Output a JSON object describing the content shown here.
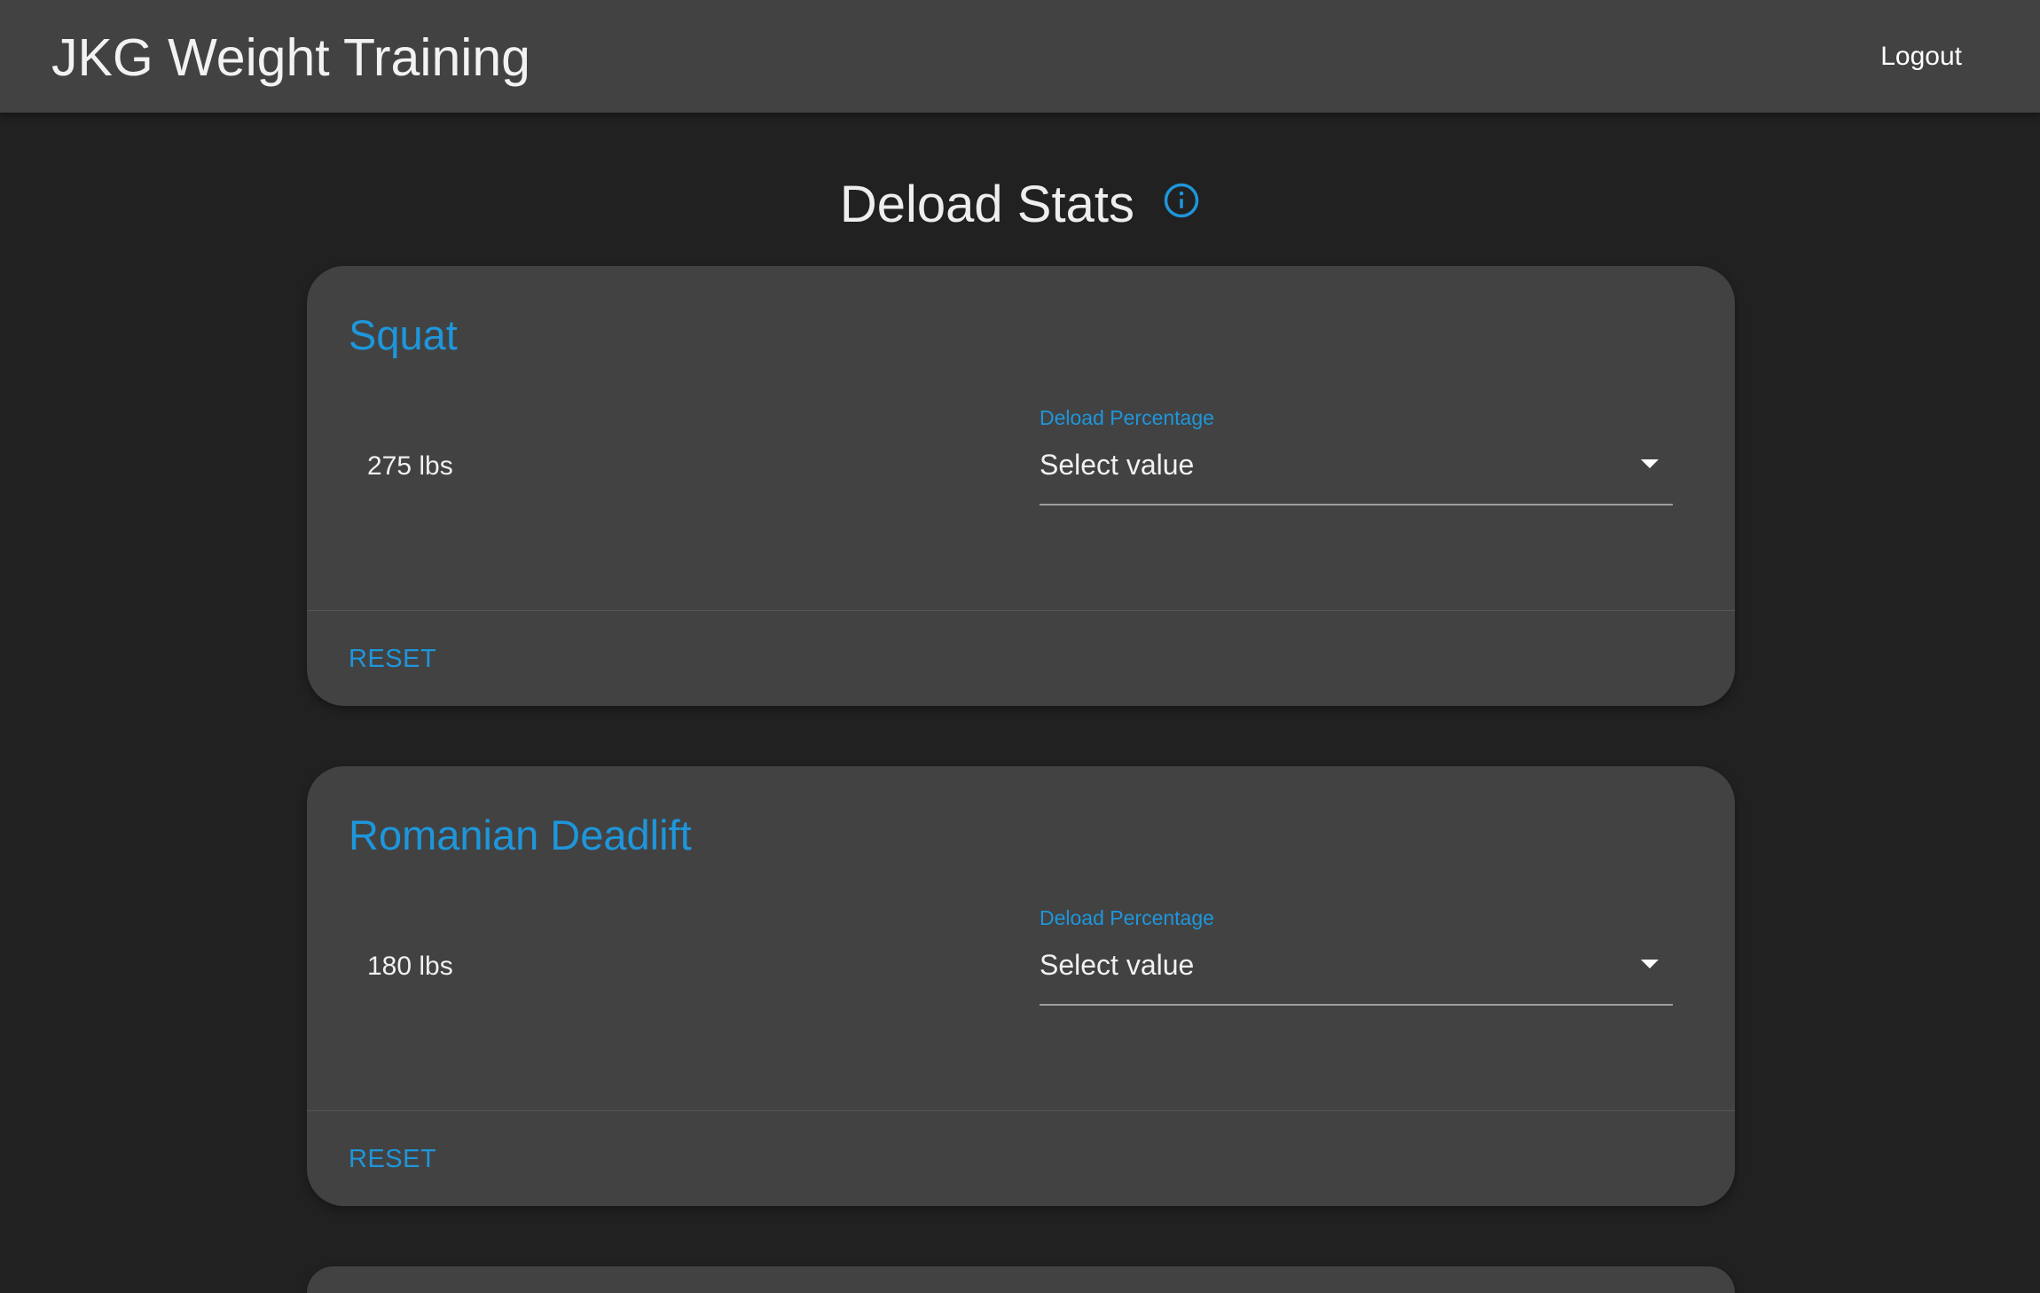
{
  "header": {
    "app_title": "JKG Weight Training",
    "logout_label": "Logout"
  },
  "page": {
    "title": "Deload Stats",
    "info_icon": "info-circle-icon"
  },
  "colors": {
    "background": "#212121",
    "surface": "#424242",
    "accent": "#1e96db",
    "text": "#f0f0f0"
  },
  "cards": [
    {
      "exercise": "Squat",
      "weight": "275 lbs",
      "field_label": "Deload Percentage",
      "field_value": "Select value",
      "reset_label": "RESET"
    },
    {
      "exercise": "Romanian Deadlift",
      "weight": "180 lbs",
      "field_label": "Deload Percentage",
      "field_value": "Select value",
      "reset_label": "RESET"
    }
  ]
}
